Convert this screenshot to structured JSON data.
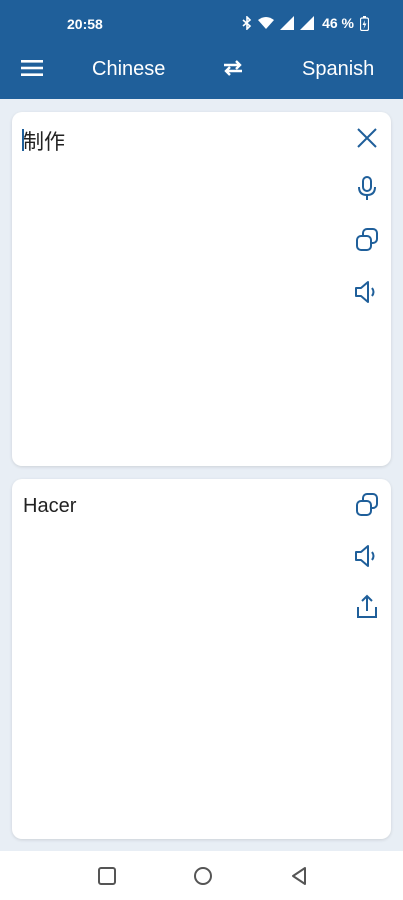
{
  "status": {
    "time": "20:58",
    "battery_text": "46 %"
  },
  "header": {
    "source_language": "Chinese",
    "target_language": "Spanish",
    "swap_icon": "swap-arrows-icon",
    "menu_icon": "hamburger-menu-icon"
  },
  "source_card": {
    "text": "制作",
    "icons": [
      "close-icon",
      "microphone-icon",
      "copy-icon",
      "speaker-icon"
    ]
  },
  "target_card": {
    "text": "Hacer",
    "icons": [
      "copy-icon",
      "speaker-icon",
      "share-icon"
    ]
  },
  "colors": {
    "primary": "#1f5f9a",
    "background": "#e8eef5",
    "card": "#ffffff"
  }
}
